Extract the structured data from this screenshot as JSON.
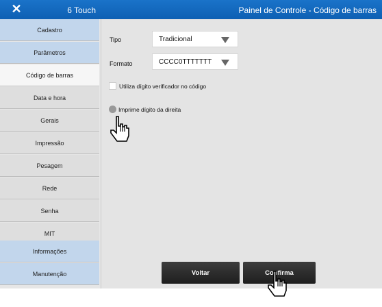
{
  "titlebar": {
    "close_glyph": "✕",
    "app_name": "6 Touch",
    "panel_title": "Painel de Controle - Código de barras",
    "color": "#1a73c9"
  },
  "sidebar": {
    "items": [
      {
        "label": "Cadastro",
        "style": "blue"
      },
      {
        "label": "Parâmetros",
        "style": "blue"
      },
      {
        "label": "Código de barras",
        "style": "active"
      },
      {
        "label": "Data e hora",
        "style": "gray"
      },
      {
        "label": "Gerais",
        "style": "gray"
      },
      {
        "label": "Impressão",
        "style": "gray"
      },
      {
        "label": "Pesagem",
        "style": "gray"
      },
      {
        "label": "Rede",
        "style": "gray"
      },
      {
        "label": "Senha",
        "style": "gray"
      },
      {
        "label": "MIT",
        "style": "gray"
      },
      {
        "label": "Informações",
        "style": "blue"
      },
      {
        "label": "Manutenção",
        "style": "blue"
      }
    ]
  },
  "form": {
    "tipo_label": "Tipo",
    "tipo_value": "Tradicional",
    "formato_label": "Formato",
    "formato_value": "CCCC0TTTTTTT",
    "checkbox_label": "Utiliza dígito verificador no código",
    "checkbox_checked": false,
    "radio_label": "Imprime dígito da direita",
    "radio_selected": false
  },
  "buttons": {
    "back_label": "Voltar",
    "confirm_label": "Confirma"
  },
  "icons": {
    "cursor": "hand-pointer-icon",
    "close": "close-icon",
    "dropdown": "chevron-down-icon"
  }
}
